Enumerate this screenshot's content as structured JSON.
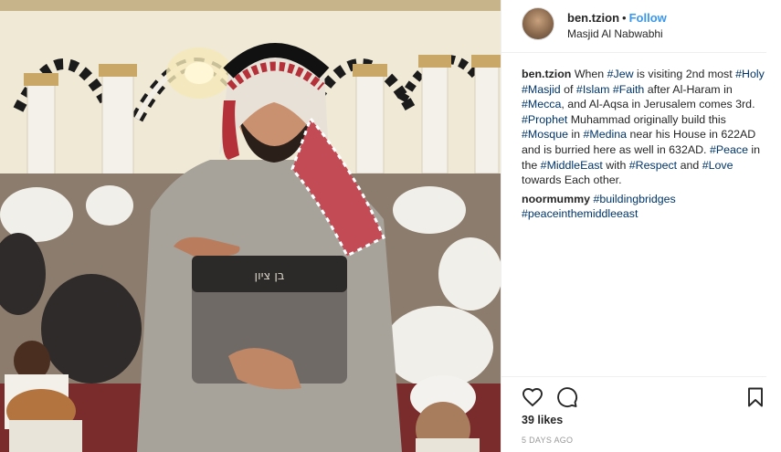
{
  "photo": {
    "icon": "photo-image",
    "bag_text": "בן ציון"
  },
  "header": {
    "username": "ben.tzion",
    "separator": "•",
    "follow_label": "Follow",
    "location": "Masjid Al Nabwabhi"
  },
  "caption": {
    "username": "ben.tzion",
    "segments": [
      {
        "text": "When ",
        "tag": false
      },
      {
        "text": "#Jew",
        "tag": true
      },
      {
        "text": " is visiting 2nd most ",
        "tag": false
      },
      {
        "text": "#Holy",
        "tag": true
      },
      {
        "text": " ",
        "tag": false
      },
      {
        "text": "#Masjid",
        "tag": true
      },
      {
        "text": " of ",
        "tag": false
      },
      {
        "text": "#Islam",
        "tag": true
      },
      {
        "text": " ",
        "tag": false
      },
      {
        "text": "#Faith",
        "tag": true
      },
      {
        "text": " after Al-Haram in ",
        "tag": false
      },
      {
        "text": "#Mecca",
        "tag": true
      },
      {
        "text": ", and Al-Aqsa in Jerusalem comes 3rd. ",
        "tag": false
      },
      {
        "text": "#Prophet",
        "tag": true
      },
      {
        "text": " Muhammad originally build this ",
        "tag": false
      },
      {
        "text": "#Mosque",
        "tag": true
      },
      {
        "text": " in ",
        "tag": false
      },
      {
        "text": "#Medina",
        "tag": true
      },
      {
        "text": " near his House in 622AD and is burried here as well in 632AD. ",
        "tag": false
      },
      {
        "text": "#Peace",
        "tag": true
      },
      {
        "text": " in the ",
        "tag": false
      },
      {
        "text": "#MiddleEast",
        "tag": true
      },
      {
        "text": " with ",
        "tag": false
      },
      {
        "text": "#Respect",
        "tag": true
      },
      {
        "text": " and ",
        "tag": false
      },
      {
        "text": "#Love",
        "tag": true
      },
      {
        "text": " towards Each other.",
        "tag": false
      }
    ]
  },
  "comment": {
    "username": "noormummy",
    "tags": [
      "#buildingbridges",
      "#peaceinthemiddleeast"
    ]
  },
  "actions": {
    "like_icon": "heart-icon",
    "comment_icon": "comment-icon",
    "save_icon": "bookmark-icon"
  },
  "likes_text": "39 likes",
  "time_text": "5 DAYS AGO",
  "colors": {
    "link_blue": "#3897f0",
    "hashtag": "#003569",
    "text": "#262626",
    "muted": "#999999",
    "border": "#efefef"
  }
}
